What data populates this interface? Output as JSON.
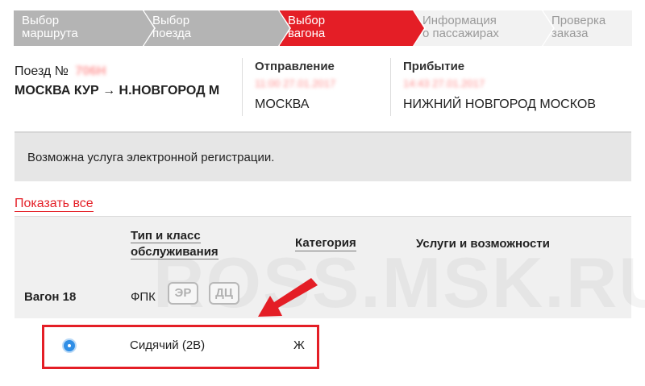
{
  "steps": [
    {
      "line1": "Выбор",
      "line2": "маршрута",
      "state": "done"
    },
    {
      "line1": "Выбор",
      "line2": "поезда",
      "state": "done"
    },
    {
      "line1": "Выбор",
      "line2": "вагона",
      "state": "active"
    },
    {
      "line1": "Информация",
      "line2": "о пассажирах",
      "state": "pending"
    },
    {
      "line1": "Проверка",
      "line2": "заказа",
      "state": "pending"
    }
  ],
  "train": {
    "number_label": "Поезд №",
    "number_value": "706Н",
    "route": "МОСКВА КУР → Н.НОВГОРОД М"
  },
  "departure": {
    "title": "Отправление",
    "time": "11:00 27.01.2017",
    "city": "МОСКВА"
  },
  "arrival": {
    "title": "Прибытие",
    "time": "14:43 27.01.2017",
    "city": "НИЖНИЙ НОВГОРОД МОСКОВ"
  },
  "notice": "Возможна услуга электронной регистрации.",
  "show_all": "Показать все",
  "table": {
    "col_type_line1": "Тип и класс",
    "col_type_line2": "обслуживания",
    "col_category": "Категория",
    "col_services": "Услуги и возможности"
  },
  "wagon": {
    "label": "Вагон 18",
    "class": "ФПК",
    "badges": [
      "ЭР",
      "ДЦ"
    ]
  },
  "seat": {
    "type": "Сидячий (2В)",
    "category": "Ж",
    "selected": true
  },
  "watermark": "ROSS.MSK.RU",
  "colors": {
    "accent": "#e41e26",
    "step_done": "#b4b4b4",
    "step_pending": "#f2f2f2",
    "radio": "#2f8ee6"
  }
}
